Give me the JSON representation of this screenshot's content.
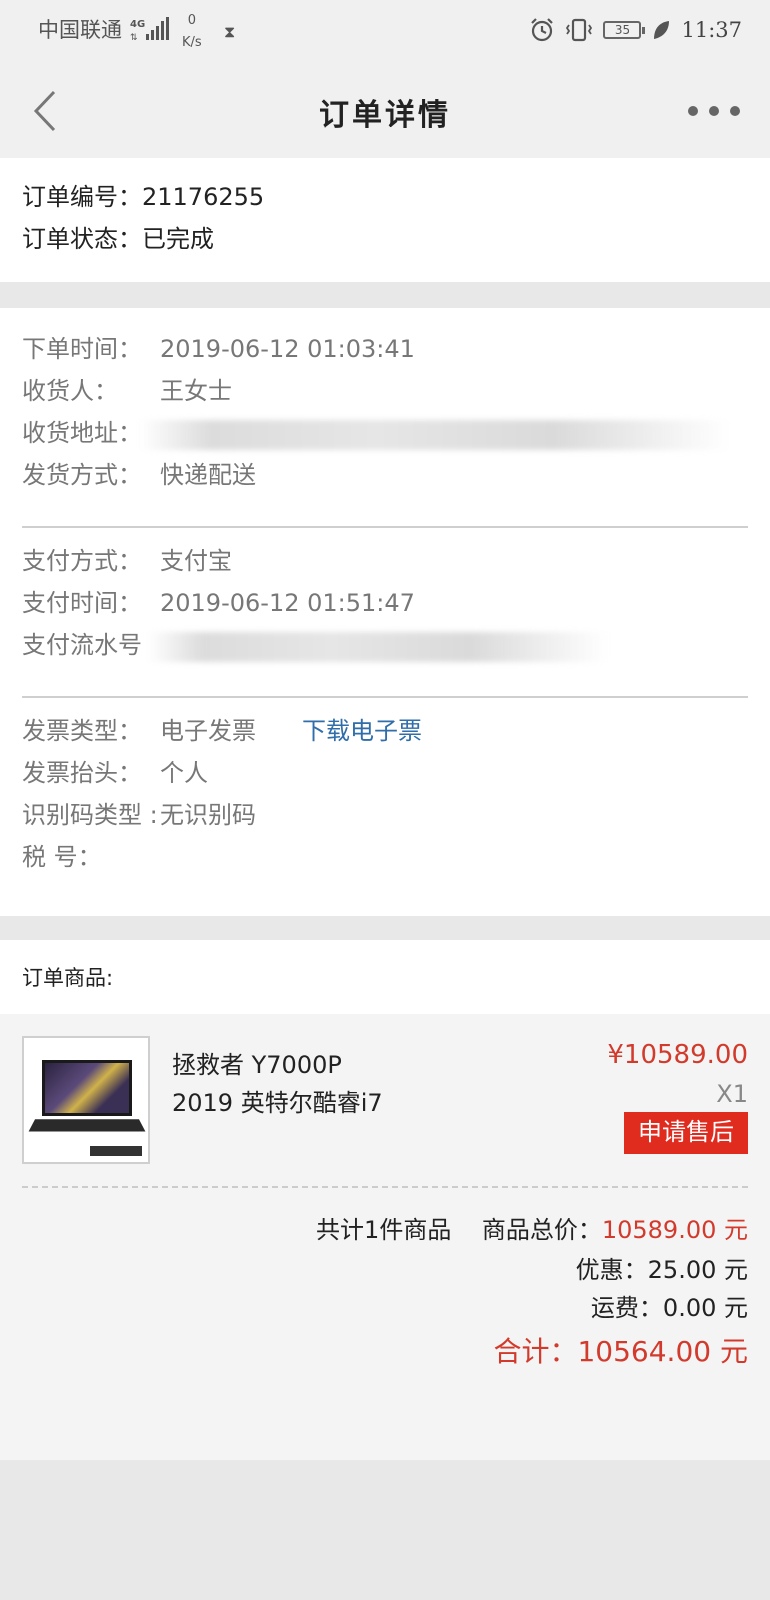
{
  "statusbar": {
    "carrier": "中国联通",
    "network": "4G",
    "speed_value": "0",
    "speed_unit": "K/s",
    "battery": "35",
    "time": "11:37"
  },
  "nav": {
    "title": "订单详情"
  },
  "order": {
    "number_label": "订单编号：",
    "number": "21176255",
    "status_label": "订单状态：",
    "status": "已完成"
  },
  "shipping": {
    "order_time_label": "下单时间：",
    "order_time": "2019-06-12 01:03:41",
    "receiver_label": "收货人：",
    "receiver": "王女士",
    "address_label": "收货地址：",
    "delivery_label": "发货方式：",
    "delivery": "快递配送"
  },
  "payment": {
    "method_label": "支付方式：",
    "method": "支付宝",
    "time_label": "支付时间：",
    "time": "2019-06-12 01:51:47",
    "serial_label": "支付流水号"
  },
  "invoice": {
    "type_label": "发票类型：",
    "type": "电子发票",
    "download_link": "下载电子票",
    "title_label": "发票抬头：",
    "title": "个人",
    "idcode_label": "识别码类型 :",
    "idcode": "无识别码",
    "tax_label": "税 号："
  },
  "goods": {
    "header": "订单商品:",
    "item": {
      "name_line1": "拯救者 Y7000P",
      "name_line2": "2019 英特尔酷睿i7",
      "price": "¥10589.00",
      "qty": "X1",
      "aftersale_button": "申请售后"
    },
    "summary": {
      "count_text": "共计1件商品",
      "subtotal_label": "商品总价：",
      "subtotal": "10589.00 元",
      "discount_label": "优惠：",
      "discount": "25.00 元",
      "shipping_label": "运费：",
      "shipping": "0.00 元",
      "total_label": "合计：",
      "total": "10564.00 元"
    }
  },
  "colors": {
    "accent_red": "#d23a2c",
    "link_blue": "#2f6eaa",
    "button_red": "#e02b1f"
  }
}
